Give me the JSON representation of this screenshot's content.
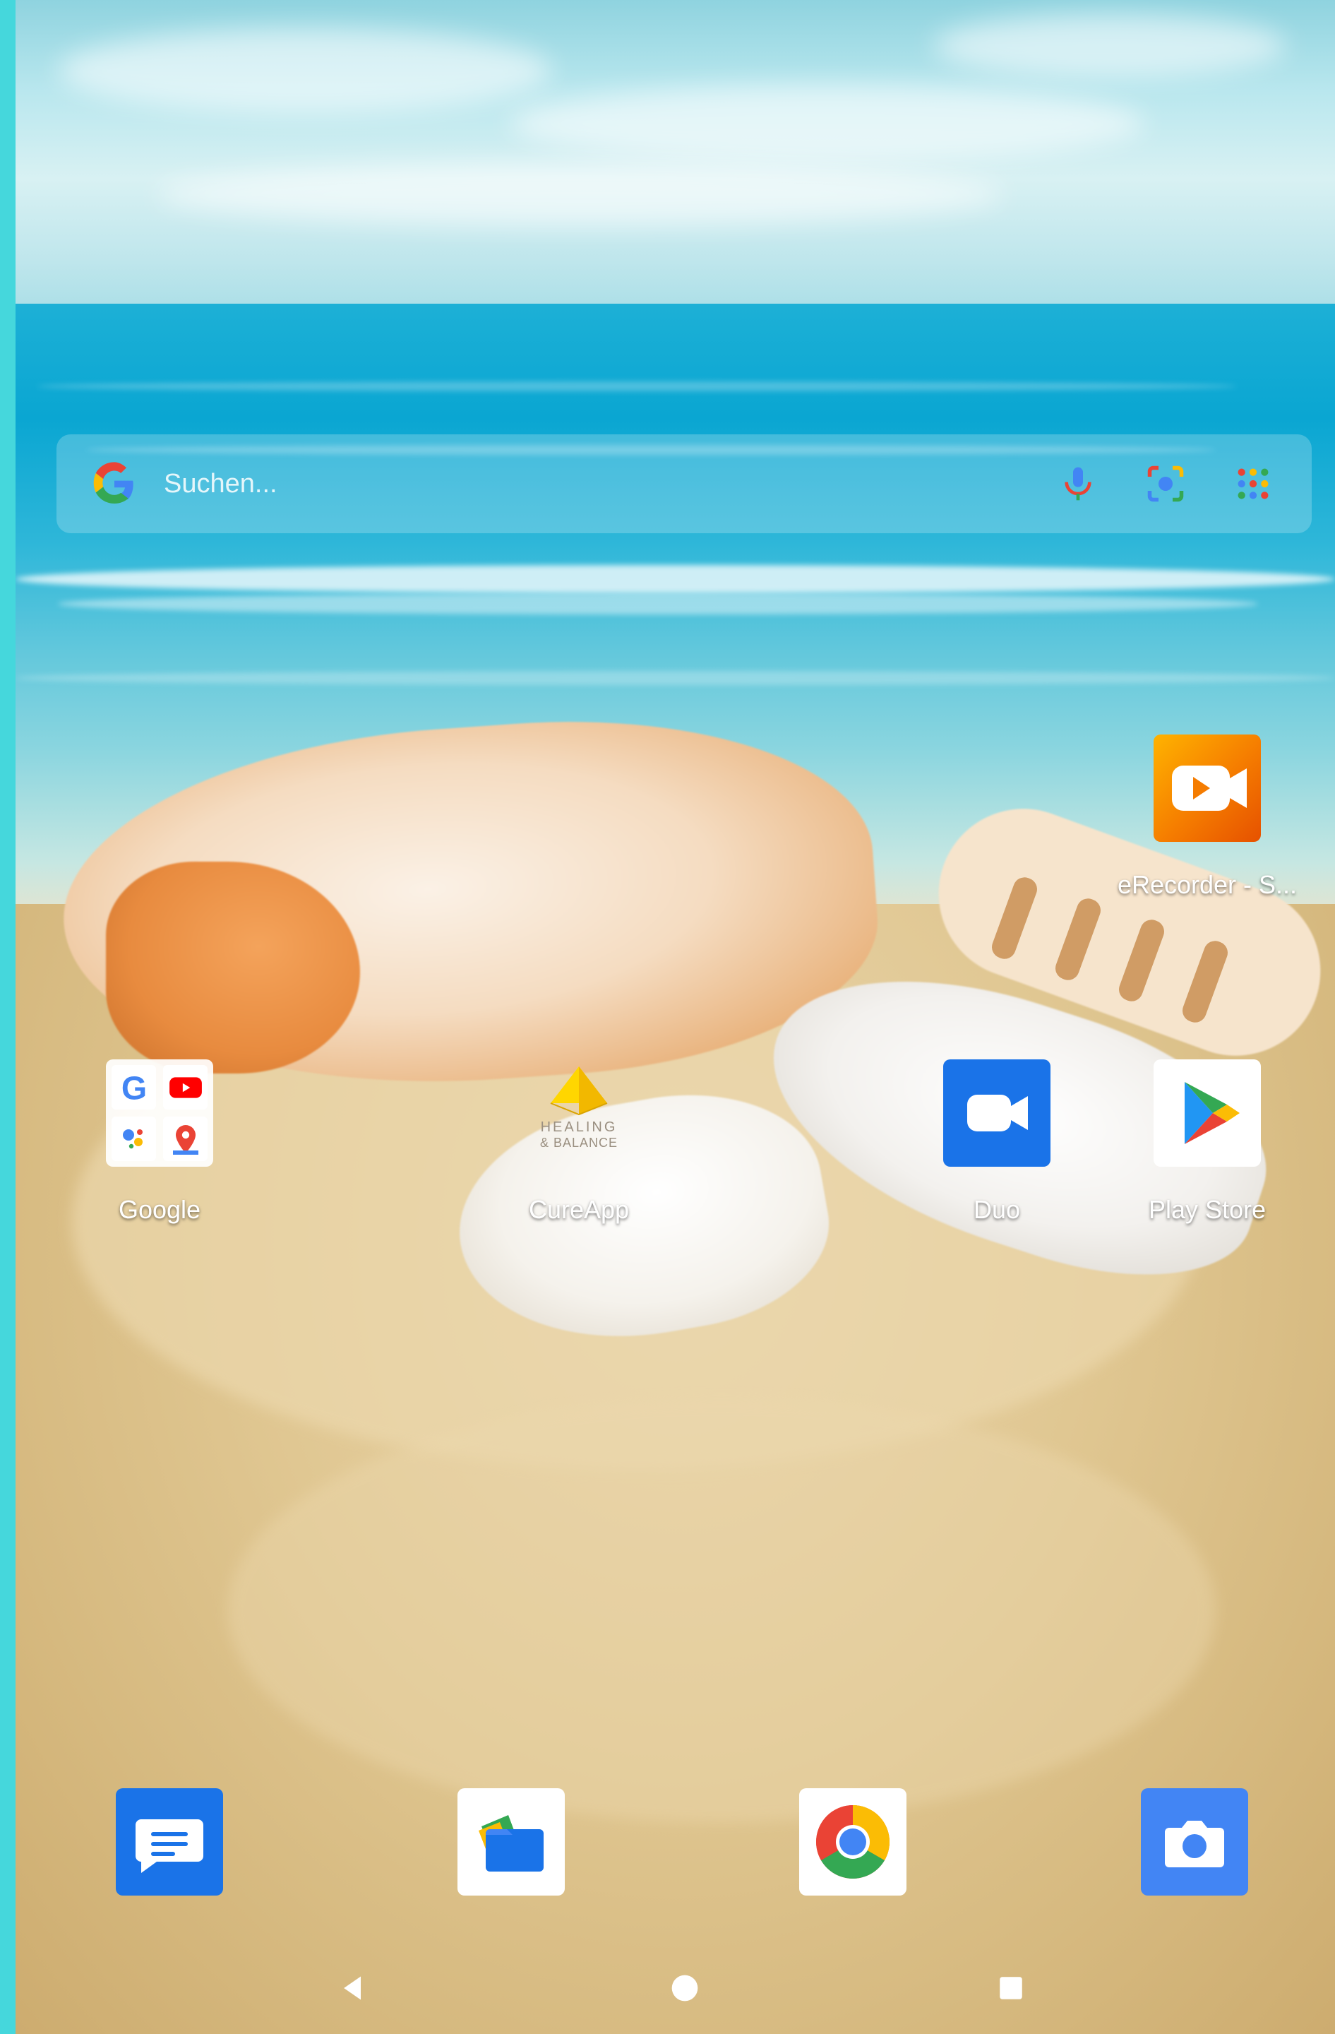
{
  "search": {
    "placeholder": "Suchen...",
    "icons": [
      "google-g-icon",
      "microphone-icon",
      "google-lens-icon",
      "apps-grid-icon"
    ]
  },
  "apps": {
    "recorder": {
      "label": "eRecorder - S...",
      "icon": "video-recorder-icon",
      "color": "#f57c00"
    },
    "google_folder": {
      "label": "Google",
      "icons": [
        "google-icon",
        "youtube-icon",
        "assistant-icon",
        "maps-icon"
      ]
    },
    "cureapp": {
      "label": "CureApp",
      "logo_text_1": "HEALING",
      "logo_text_2": "& BALANCE",
      "icon": "pyramid-icon"
    },
    "duo": {
      "label": "Duo",
      "icon": "video-camera-icon",
      "color": "#1a73e8"
    },
    "play_store": {
      "label": "Play Store",
      "icon": "play-store-icon"
    }
  },
  "dock": [
    {
      "name": "messages",
      "icon": "messages-icon",
      "color": "#1a73e8"
    },
    {
      "name": "files",
      "icon": "files-icon"
    },
    {
      "name": "chrome",
      "icon": "chrome-icon"
    },
    {
      "name": "camera",
      "icon": "camera-icon",
      "color": "#4285f4"
    }
  ],
  "navigation": [
    "back-icon",
    "home-icon",
    "recents-icon"
  ]
}
